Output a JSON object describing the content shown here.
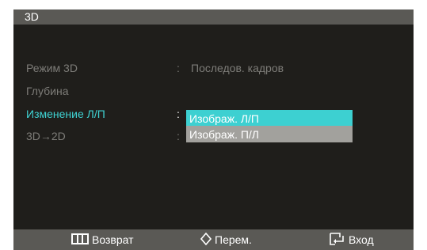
{
  "title": "3D",
  "menu": [
    {
      "label": "Режим 3D",
      "value": "Последов. кадров"
    },
    {
      "label": "Глубина",
      "value": ""
    },
    {
      "label": "Изменение Л/П",
      "value": ""
    },
    {
      "label": "3D→2D",
      "value": ""
    }
  ],
  "dropdown": {
    "options": [
      "Изображ. Л/П",
      "Изображ. П/Л"
    ],
    "selected": "Изображ. Л/П"
  },
  "footer": {
    "return_label": "Возврат",
    "move_label": "Перем.",
    "enter_label": "Вход"
  },
  "colors": {
    "active": "#3fd3d3",
    "panel": "#1f1e1b",
    "bar": "#5a5955",
    "inactive_text": "#7d7c78",
    "dropdown_bg": "#a2a19d"
  },
  "icons": {
    "return": "menu-bars-icon",
    "move": "diamond-arrows-icon",
    "enter": "enter-source-icon"
  }
}
